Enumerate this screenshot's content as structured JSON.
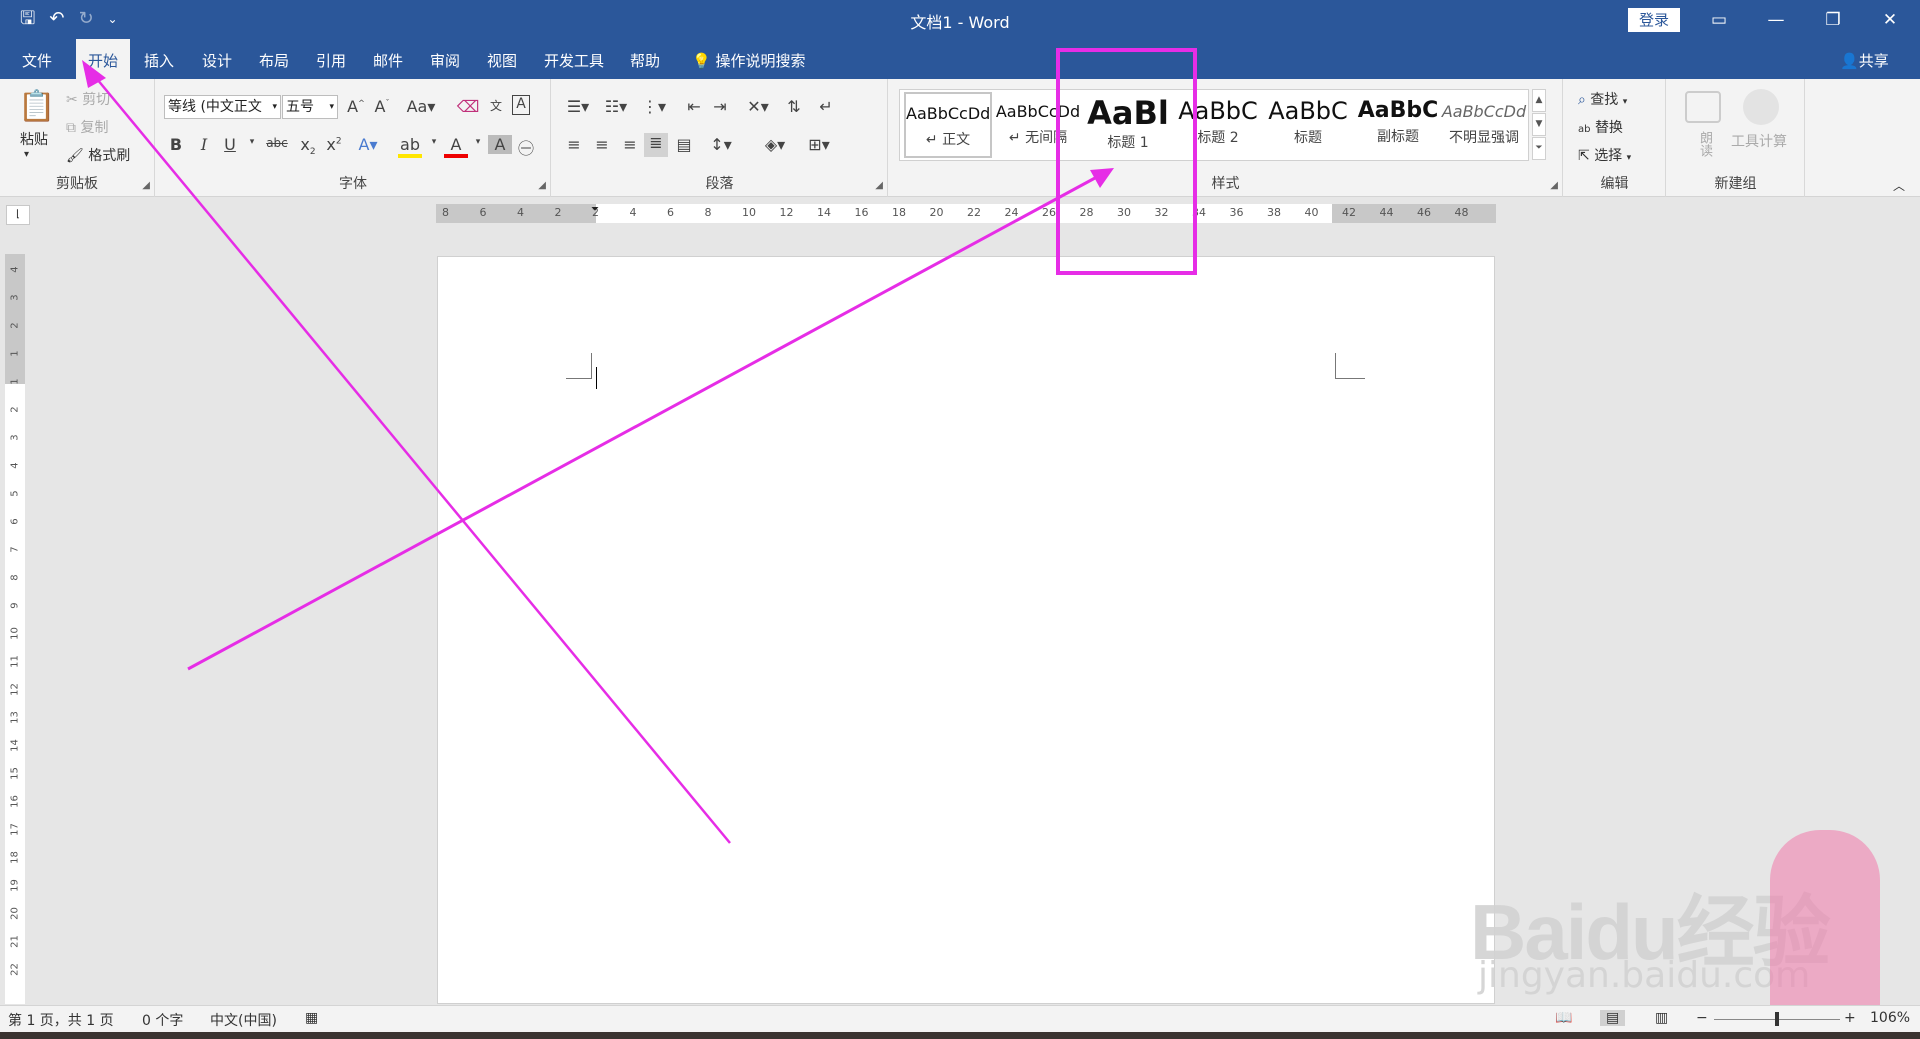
{
  "app": {
    "title": "文档1 - Word",
    "login_label": "登录"
  },
  "tabs": [
    "文件",
    "开始",
    "插入",
    "设计",
    "布局",
    "引用",
    "邮件",
    "审阅",
    "视图",
    "开发工具",
    "帮助"
  ],
  "tell_me": "操作说明搜索",
  "share": "共享",
  "clipboard": {
    "paste": "粘贴",
    "cut": "剪切",
    "copy": "复制",
    "format_painter": "格式刷",
    "label": "剪贴板"
  },
  "font": {
    "name": "等线 (中文正文",
    "size": "五号",
    "label": "字体"
  },
  "paragraph": {
    "label": "段落"
  },
  "styles": {
    "label": "样式",
    "items": [
      {
        "preview": "AaBbCcDd",
        "name": "↵ 正文"
      },
      {
        "preview": "AaBbCcDd",
        "name": "↵ 无间隔"
      },
      {
        "preview": "AaBl",
        "name": "标题 1"
      },
      {
        "preview": "AaBbC",
        "name": "标题 2"
      },
      {
        "preview": "AaBbC",
        "name": "标题"
      },
      {
        "preview": "AaBbC",
        "name": "副标题"
      },
      {
        "preview": "AaBbCcDd",
        "name": "不明显强调"
      }
    ]
  },
  "editing": {
    "find": "查找",
    "replace": "替换",
    "select": "选择",
    "label": "编辑"
  },
  "newgroup": {
    "read_aloud": "朗读",
    "tool_calc": "工具计算",
    "label": "新建组"
  },
  "ruler": {
    "h": [
      "8",
      "6",
      "4",
      "2",
      "2",
      "4",
      "6",
      "8",
      "10",
      "12",
      "14",
      "16",
      "18",
      "20",
      "22",
      "24",
      "26",
      "28",
      "30",
      "32",
      "34",
      "36",
      "38",
      "40",
      "42",
      "44",
      "46",
      "48"
    ],
    "v": [
      "4",
      "3",
      "2",
      "1",
      "1",
      "2",
      "3",
      "4",
      "5",
      "6",
      "7",
      "8",
      "9",
      "10",
      "11",
      "12",
      "13",
      "14",
      "15",
      "16",
      "17",
      "18",
      "19",
      "20",
      "21",
      "22"
    ]
  },
  "status": {
    "page": "第 1 页，共 1 页",
    "words": "0 个字",
    "lang": "中文(中国)",
    "zoom": "106%"
  },
  "watermark": {
    "brand": "Baidu经验",
    "url": "jingyan.baidu.com"
  },
  "colors": {
    "brand": "#2b579a",
    "annotation": "#e62de6",
    "ribbon": "#f3f3f3"
  }
}
